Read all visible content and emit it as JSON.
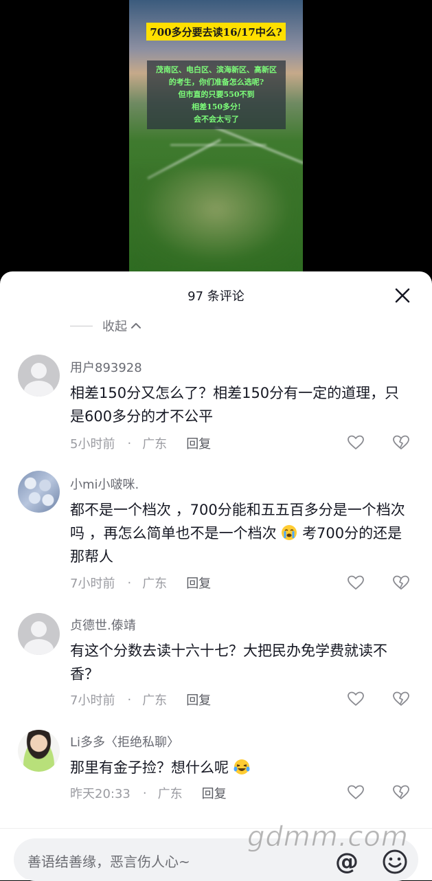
{
  "video": {
    "title": "700多分要去读16/17中么?",
    "overlay_lines": [
      "茂南区、电白区、滨海新区、高新区",
      "的考生，你们准备怎么选呢?",
      "但市直的只要550不到",
      "相差150多分!",
      "会不会太亏了"
    ]
  },
  "header": {
    "comment_count": "97 条评论",
    "collapse_label": "收起"
  },
  "comments": [
    {
      "username": "用户893928",
      "content": "相差150分又怎么了？相差150分有一定的道理，只是600多分的才不公平",
      "time": "5小时前",
      "location": "广东",
      "reply": "回复",
      "avatar": "default-avatar"
    },
    {
      "username": "小mi小啵咪.",
      "content_a": "都不是一个档次 ，700分能和五五百多分是一个档次吗 ，再怎么简单也不是一个档次",
      "content_b": "考700分的还是那帮人",
      "emoji": "crying-face-emoji",
      "time": "7小时前",
      "location": "广东",
      "reply": "回复",
      "avatar": "bottles-avatar"
    },
    {
      "username": "贞德世.傣靖",
      "content": "有这个分数去读十六十七？大把民办免学费就读不香？",
      "time": "7小时前",
      "location": "广东",
      "reply": "回复",
      "avatar": "default-avatar"
    },
    {
      "username": "Li多多〈拒绝私聊〉",
      "content": "那里有金子捡？想什么呢",
      "emoji": "laughing-tears-emoji",
      "time": "昨天20:33",
      "location": "广东",
      "reply": "回复",
      "avatar": "girl-avatar"
    }
  ],
  "input": {
    "placeholder": "善语结善缘，恶言伤人心~",
    "at_symbol": "@"
  },
  "watermark": "gdmm.com",
  "colors": {
    "title_bg": "#ffe000",
    "overlay_text": "#7dff7a",
    "primary_text": "#161823",
    "secondary_text": "#9a9ba1"
  }
}
